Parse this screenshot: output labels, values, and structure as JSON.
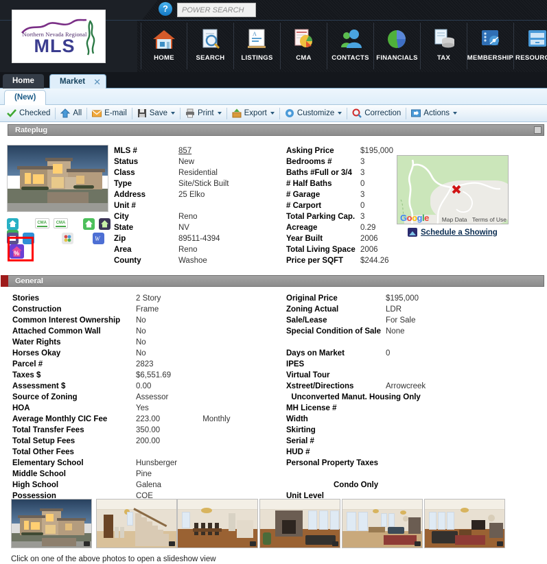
{
  "header": {
    "logo_line1": "Northern Nevada Regional",
    "logo_line2": "MLS",
    "help_icon": "help-icon",
    "search_placeholder": "POWER SEARCH",
    "search_value": "",
    "nav": [
      {
        "label": "HOME",
        "icon": "house-icon"
      },
      {
        "label": "SEARCH",
        "icon": "magnifier-document-icon"
      },
      {
        "label": "LISTINGS",
        "icon": "easel-chart-icon"
      },
      {
        "label": "CMA",
        "icon": "pie-chart-report-icon"
      },
      {
        "label": "CONTACTS",
        "icon": "people-icon"
      },
      {
        "label": "FINANCIALS",
        "icon": "pie-chart-icon"
      },
      {
        "label": "TAX",
        "icon": "documents-database-icon"
      },
      {
        "label": "MEMBERSHIP",
        "icon": "network-card-icon"
      },
      {
        "label": "RESOURCES",
        "icon": "file-cabinet-icon"
      }
    ]
  },
  "tabs": {
    "home": "Home",
    "market": "Market",
    "close_icon": "close-icon",
    "subtab": "(New)"
  },
  "toolbar": [
    {
      "label": "Checked",
      "icon": "green-check-icon",
      "caret": false
    },
    {
      "label": "All",
      "icon": "blue-arrow-up-icon",
      "caret": false
    },
    {
      "label": "E-mail",
      "icon": "envelope-icon",
      "caret": false
    },
    {
      "label": "Save",
      "icon": "floppy-disk-icon",
      "caret": true
    },
    {
      "label": "Print",
      "icon": "printer-icon",
      "caret": true
    },
    {
      "label": "Export",
      "icon": "export-box-icon",
      "caret": true
    },
    {
      "label": "Customize",
      "icon": "gear-icon",
      "caret": true
    },
    {
      "label": "Correction",
      "icon": "magnifier-red-icon",
      "caret": false
    },
    {
      "label": "Actions",
      "icon": "window-arrow-icon",
      "caret": true
    }
  ],
  "sections": {
    "rateplug": "Rateplug",
    "general": "General"
  },
  "listing": {
    "photo_alt": "property-exterior-dusk",
    "left_fields": [
      {
        "label": "MLS #",
        "value": "857",
        "link": true
      },
      {
        "label": "Status",
        "value": "New"
      },
      {
        "label": "Class",
        "value": "Residential"
      },
      {
        "label": "Type",
        "value": "Site/Stick Built"
      },
      {
        "label": "Address",
        "value": "25 Elko"
      },
      {
        "label": "Unit #",
        "value": ""
      },
      {
        "label": "City",
        "value": "Reno"
      },
      {
        "label": "State",
        "value": "NV"
      },
      {
        "label": "Zip",
        "value": "89511-4394"
      },
      {
        "label": "Area",
        "value": "Reno"
      },
      {
        "label": "County",
        "value": "Washoe"
      }
    ],
    "right_fields": [
      {
        "label": "Asking Price",
        "value": "$195,000"
      },
      {
        "label": "Bedrooms #",
        "value": "3"
      },
      {
        "label": "Baths #Full or 3/4",
        "value": "3"
      },
      {
        "label": "# Half Baths",
        "value": "0"
      },
      {
        "label": "# Garage",
        "value": "3"
      },
      {
        "label": "# Carport",
        "value": "0"
      },
      {
        "label": "Total Parking Cap.",
        "value": "3"
      },
      {
        "label": "Acreage",
        "value": "0.29"
      },
      {
        "label": "Year Built",
        "value": "2006"
      },
      {
        "label": "Total Living Space",
        "value": "2006"
      },
      {
        "label": "Price per SQFT",
        "value": "$244.26"
      }
    ],
    "map": {
      "logo": "Google",
      "map_data": "Map Data",
      "terms": "Terms of Use",
      "marker": "red-x-marker"
    },
    "schedule_showing": "Schedule a Showing",
    "icons": [
      {
        "name": "virtual-tour-icon",
        "color": "#27b0c4"
      },
      {
        "name": "cma-report-icon",
        "color": "#ffffff"
      },
      {
        "name": "cma-report-alt-icon",
        "color": "#ffffff"
      },
      {
        "name": "green-house-icon",
        "color": "#4cbf5b"
      },
      {
        "name": "dark-house-icon",
        "color": "#3b3556"
      },
      {
        "name": "dollar-check-icon",
        "color": "#3fae5a"
      },
      {
        "name": "map-marker-icon",
        "color": "#2f8fd6"
      },
      {
        "name": "color-wheel-icon",
        "color": "#e8e8e8"
      },
      {
        "name": "mortgage-calculator-icon",
        "color": "#4d6fd4"
      },
      {
        "name": "rateplug-percent-house-icon",
        "color": "#6b3fd4",
        "highlighted": true
      }
    ]
  },
  "general": {
    "left_fields": [
      {
        "label": "Stories",
        "value": "2 Story"
      },
      {
        "label": "Construction",
        "value": "Frame"
      },
      {
        "label": "Common Interest Ownership",
        "value": "No"
      },
      {
        "label": "Attached Common Wall",
        "value": "No"
      },
      {
        "label": "Water Rights",
        "value": "No"
      },
      {
        "label": "Horses Okay",
        "value": "No"
      },
      {
        "label": "Parcel #",
        "value": "2823"
      },
      {
        "label": "Taxes $",
        "value": "$6,551.69"
      },
      {
        "label": "Assessment $",
        "value": "0.00"
      },
      {
        "label": "Source of Zoning",
        "value": "Assessor"
      },
      {
        "label": "HOA",
        "value": "Yes"
      },
      {
        "label": "Average Monthly CIC Fee",
        "value": "223.00",
        "value2": "Monthly"
      },
      {
        "label": "Total Transfer Fees",
        "value": "350.00"
      },
      {
        "label": "Total Setup Fees",
        "value": "200.00"
      },
      {
        "label": "Total Other Fees",
        "value": ""
      },
      {
        "label": "Elementary School",
        "value": "Hunsberger"
      },
      {
        "label": "Middle School",
        "value": "Pine"
      },
      {
        "label": "High School",
        "value": "Galena"
      },
      {
        "label": "Possession",
        "value": "COE"
      }
    ],
    "right_fields": [
      {
        "label": "Original Price",
        "value": "$195,000"
      },
      {
        "label": "Zoning Actual",
        "value": "LDR"
      },
      {
        "label": "Sale/Lease",
        "value": "For Sale"
      },
      {
        "label": "Special Condition of Sale",
        "value": "None"
      },
      {
        "spacer": true
      },
      {
        "label": "Days on Market",
        "value": "0"
      },
      {
        "label": "IPES",
        "value": ""
      },
      {
        "label": "Virtual Tour",
        "value": ""
      },
      {
        "label": "Xstreet/Directions",
        "value": "Arrowcreek"
      },
      {
        "subhead": "Unconverted Manut. Housing Only"
      },
      {
        "label": "MH License #",
        "value": ""
      },
      {
        "label": "Width",
        "value": ""
      },
      {
        "label": "Skirting",
        "value": ""
      },
      {
        "label": "Serial #",
        "value": ""
      },
      {
        "label": "HUD #",
        "value": ""
      },
      {
        "label": "Personal Property Taxes",
        "value": ""
      },
      {
        "spacer": true
      },
      {
        "subhead": "Condo Only"
      },
      {
        "label": "Unit Level",
        "value": ""
      }
    ]
  },
  "photo_strip": {
    "caption": "Click on one of the above photos to open a slideshow view",
    "thumbs": [
      "exterior-dusk",
      "entry-staircase",
      "dining-room",
      "living-room-stone-fireplace",
      "great-room-wide",
      "family-room-fireplace"
    ]
  }
}
